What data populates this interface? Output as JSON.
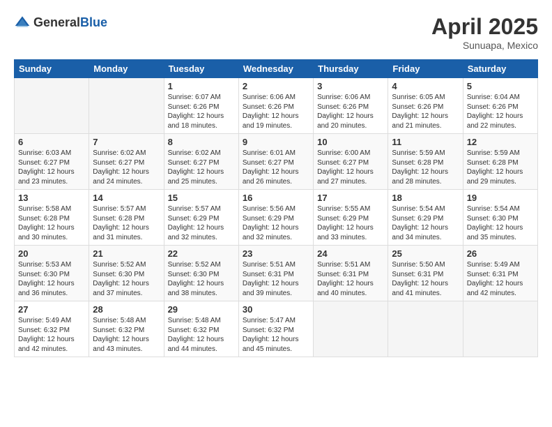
{
  "header": {
    "logo_general": "General",
    "logo_blue": "Blue",
    "month_title": "April 2025",
    "location": "Sunuapa, Mexico"
  },
  "days_of_week": [
    "Sunday",
    "Monday",
    "Tuesday",
    "Wednesday",
    "Thursday",
    "Friday",
    "Saturday"
  ],
  "weeks": [
    [
      {
        "day": "",
        "sunrise": "",
        "sunset": "",
        "daylight": ""
      },
      {
        "day": "",
        "sunrise": "",
        "sunset": "",
        "daylight": ""
      },
      {
        "day": "1",
        "sunrise": "Sunrise: 6:07 AM",
        "sunset": "Sunset: 6:26 PM",
        "daylight": "Daylight: 12 hours and 18 minutes."
      },
      {
        "day": "2",
        "sunrise": "Sunrise: 6:06 AM",
        "sunset": "Sunset: 6:26 PM",
        "daylight": "Daylight: 12 hours and 19 minutes."
      },
      {
        "day": "3",
        "sunrise": "Sunrise: 6:06 AM",
        "sunset": "Sunset: 6:26 PM",
        "daylight": "Daylight: 12 hours and 20 minutes."
      },
      {
        "day": "4",
        "sunrise": "Sunrise: 6:05 AM",
        "sunset": "Sunset: 6:26 PM",
        "daylight": "Daylight: 12 hours and 21 minutes."
      },
      {
        "day": "5",
        "sunrise": "Sunrise: 6:04 AM",
        "sunset": "Sunset: 6:26 PM",
        "daylight": "Daylight: 12 hours and 22 minutes."
      }
    ],
    [
      {
        "day": "6",
        "sunrise": "Sunrise: 6:03 AM",
        "sunset": "Sunset: 6:27 PM",
        "daylight": "Daylight: 12 hours and 23 minutes."
      },
      {
        "day": "7",
        "sunrise": "Sunrise: 6:02 AM",
        "sunset": "Sunset: 6:27 PM",
        "daylight": "Daylight: 12 hours and 24 minutes."
      },
      {
        "day": "8",
        "sunrise": "Sunrise: 6:02 AM",
        "sunset": "Sunset: 6:27 PM",
        "daylight": "Daylight: 12 hours and 25 minutes."
      },
      {
        "day": "9",
        "sunrise": "Sunrise: 6:01 AM",
        "sunset": "Sunset: 6:27 PM",
        "daylight": "Daylight: 12 hours and 26 minutes."
      },
      {
        "day": "10",
        "sunrise": "Sunrise: 6:00 AM",
        "sunset": "Sunset: 6:27 PM",
        "daylight": "Daylight: 12 hours and 27 minutes."
      },
      {
        "day": "11",
        "sunrise": "Sunrise: 5:59 AM",
        "sunset": "Sunset: 6:28 PM",
        "daylight": "Daylight: 12 hours and 28 minutes."
      },
      {
        "day": "12",
        "sunrise": "Sunrise: 5:59 AM",
        "sunset": "Sunset: 6:28 PM",
        "daylight": "Daylight: 12 hours and 29 minutes."
      }
    ],
    [
      {
        "day": "13",
        "sunrise": "Sunrise: 5:58 AM",
        "sunset": "Sunset: 6:28 PM",
        "daylight": "Daylight: 12 hours and 30 minutes."
      },
      {
        "day": "14",
        "sunrise": "Sunrise: 5:57 AM",
        "sunset": "Sunset: 6:28 PM",
        "daylight": "Daylight: 12 hours and 31 minutes."
      },
      {
        "day": "15",
        "sunrise": "Sunrise: 5:57 AM",
        "sunset": "Sunset: 6:29 PM",
        "daylight": "Daylight: 12 hours and 32 minutes."
      },
      {
        "day": "16",
        "sunrise": "Sunrise: 5:56 AM",
        "sunset": "Sunset: 6:29 PM",
        "daylight": "Daylight: 12 hours and 32 minutes."
      },
      {
        "day": "17",
        "sunrise": "Sunrise: 5:55 AM",
        "sunset": "Sunset: 6:29 PM",
        "daylight": "Daylight: 12 hours and 33 minutes."
      },
      {
        "day": "18",
        "sunrise": "Sunrise: 5:54 AM",
        "sunset": "Sunset: 6:29 PM",
        "daylight": "Daylight: 12 hours and 34 minutes."
      },
      {
        "day": "19",
        "sunrise": "Sunrise: 5:54 AM",
        "sunset": "Sunset: 6:30 PM",
        "daylight": "Daylight: 12 hours and 35 minutes."
      }
    ],
    [
      {
        "day": "20",
        "sunrise": "Sunrise: 5:53 AM",
        "sunset": "Sunset: 6:30 PM",
        "daylight": "Daylight: 12 hours and 36 minutes."
      },
      {
        "day": "21",
        "sunrise": "Sunrise: 5:52 AM",
        "sunset": "Sunset: 6:30 PM",
        "daylight": "Daylight: 12 hours and 37 minutes."
      },
      {
        "day": "22",
        "sunrise": "Sunrise: 5:52 AM",
        "sunset": "Sunset: 6:30 PM",
        "daylight": "Daylight: 12 hours and 38 minutes."
      },
      {
        "day": "23",
        "sunrise": "Sunrise: 5:51 AM",
        "sunset": "Sunset: 6:31 PM",
        "daylight": "Daylight: 12 hours and 39 minutes."
      },
      {
        "day": "24",
        "sunrise": "Sunrise: 5:51 AM",
        "sunset": "Sunset: 6:31 PM",
        "daylight": "Daylight: 12 hours and 40 minutes."
      },
      {
        "day": "25",
        "sunrise": "Sunrise: 5:50 AM",
        "sunset": "Sunset: 6:31 PM",
        "daylight": "Daylight: 12 hours and 41 minutes."
      },
      {
        "day": "26",
        "sunrise": "Sunrise: 5:49 AM",
        "sunset": "Sunset: 6:31 PM",
        "daylight": "Daylight: 12 hours and 42 minutes."
      }
    ],
    [
      {
        "day": "27",
        "sunrise": "Sunrise: 5:49 AM",
        "sunset": "Sunset: 6:32 PM",
        "daylight": "Daylight: 12 hours and 42 minutes."
      },
      {
        "day": "28",
        "sunrise": "Sunrise: 5:48 AM",
        "sunset": "Sunset: 6:32 PM",
        "daylight": "Daylight: 12 hours and 43 minutes."
      },
      {
        "day": "29",
        "sunrise": "Sunrise: 5:48 AM",
        "sunset": "Sunset: 6:32 PM",
        "daylight": "Daylight: 12 hours and 44 minutes."
      },
      {
        "day": "30",
        "sunrise": "Sunrise: 5:47 AM",
        "sunset": "Sunset: 6:32 PM",
        "daylight": "Daylight: 12 hours and 45 minutes."
      },
      {
        "day": "",
        "sunrise": "",
        "sunset": "",
        "daylight": ""
      },
      {
        "day": "",
        "sunrise": "",
        "sunset": "",
        "daylight": ""
      },
      {
        "day": "",
        "sunrise": "",
        "sunset": "",
        "daylight": ""
      }
    ]
  ]
}
